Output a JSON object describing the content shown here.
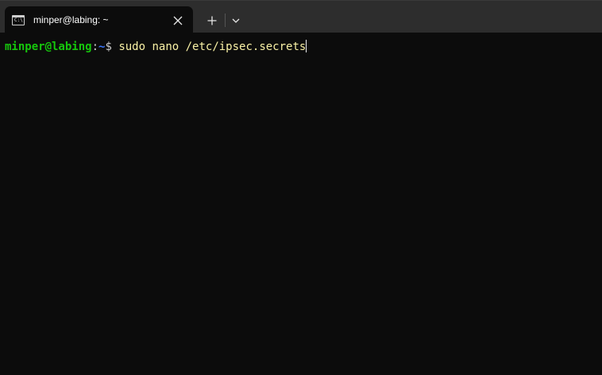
{
  "window": {
    "tab": {
      "icon": "terminal-icon",
      "icon_text": "C:\\",
      "title": "minper@labing: ~",
      "close_icon": "close-icon"
    },
    "new_tab_icon": "plus-icon",
    "dropdown_icon": "chevron-down-icon"
  },
  "terminal": {
    "prompt_user": "minper@labing",
    "prompt_colon": ":",
    "prompt_path": "~",
    "prompt_symbol": "$ ",
    "command": "sudo nano /etc/ipsec.secrets"
  },
  "colors": {
    "background": "#0c0c0c",
    "titlebar": "#2d2d2d",
    "prompt_user": "#16c60c",
    "prompt_path": "#3b78ff",
    "command_text": "#f9f1a5"
  }
}
